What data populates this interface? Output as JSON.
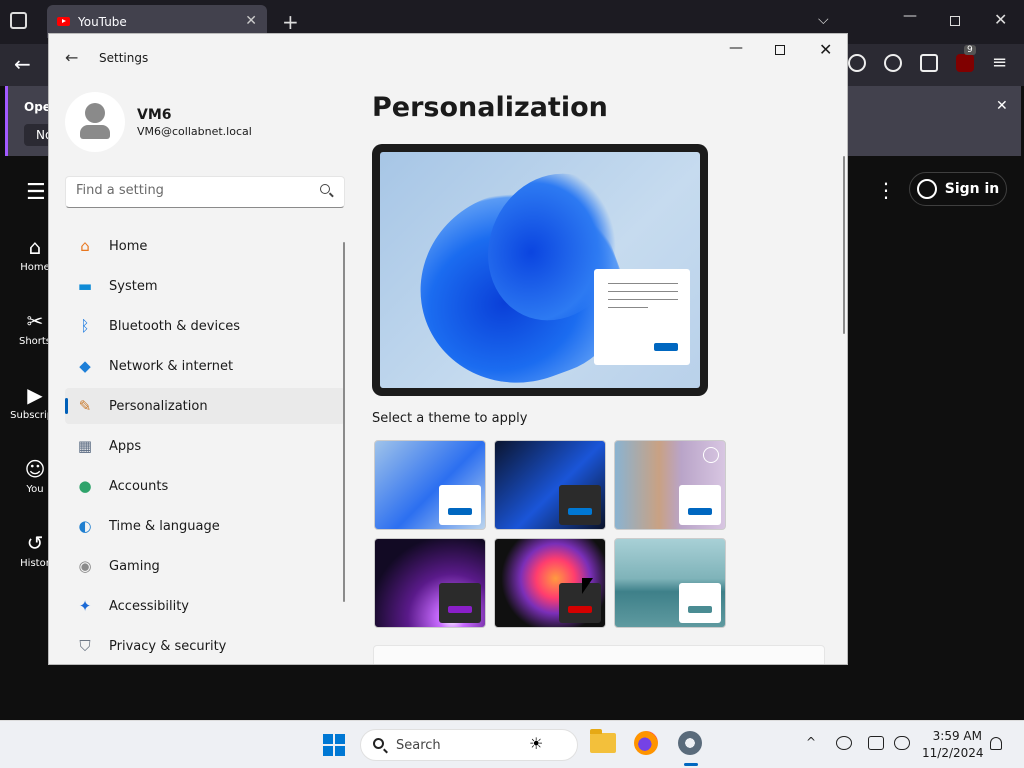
{
  "browser": {
    "tab_title": "YouTube",
    "notification": {
      "text": "Oper",
      "button": "No"
    },
    "extension_badge": "9"
  },
  "youtube": {
    "sidebar": [
      {
        "label": "Home",
        "icon": "home-icon",
        "glyph": "⌂"
      },
      {
        "label": "Shorts",
        "icon": "shorts-icon",
        "glyph": "✂"
      },
      {
        "label": "Subscripti",
        "icon": "subscriptions-icon",
        "glyph": "▶"
      },
      {
        "label": "You",
        "icon": "you-icon",
        "glyph": "☺"
      },
      {
        "label": "Histor",
        "icon": "history-icon",
        "glyph": "↺"
      }
    ],
    "sign_in": "Sign in"
  },
  "settings": {
    "window_title": "Settings",
    "user": {
      "name": "VM6",
      "email": "VM6@collabnet.local"
    },
    "search": {
      "placeholder": "Find a setting"
    },
    "nav": [
      {
        "label": "Home",
        "icon": "home-icon",
        "glyph": "⌂",
        "color": "#e8761e",
        "active": false
      },
      {
        "label": "System",
        "icon": "system-icon",
        "glyph": "▬",
        "color": "#0f8bd6",
        "active": false
      },
      {
        "label": "Bluetooth & devices",
        "icon": "bluetooth-icon",
        "glyph": "ᛒ",
        "color": "#1c7ae0",
        "active": false
      },
      {
        "label": "Network & internet",
        "icon": "wifi-icon",
        "glyph": "◆",
        "color": "#1d7fd8",
        "active": false
      },
      {
        "label": "Personalization",
        "icon": "brush-icon",
        "glyph": "✎",
        "color": "#c97a2c",
        "active": true
      },
      {
        "label": "Apps",
        "icon": "apps-icon",
        "glyph": "▦",
        "color": "#5b6b82",
        "active": false
      },
      {
        "label": "Accounts",
        "icon": "accounts-icon",
        "glyph": "●",
        "color": "#2fa36b",
        "active": false
      },
      {
        "label": "Time & language",
        "icon": "globe-icon",
        "glyph": "◐",
        "color": "#1f7fd0",
        "active": false
      },
      {
        "label": "Gaming",
        "icon": "gamepad-icon",
        "glyph": "◉",
        "color": "#8a8a8a",
        "active": false
      },
      {
        "label": "Accessibility",
        "icon": "accessibility-icon",
        "glyph": "✦",
        "color": "#1c6ad6",
        "active": false
      },
      {
        "label": "Privacy & security",
        "icon": "shield-icon",
        "glyph": "⛉",
        "color": "#6d7785",
        "active": false
      }
    ],
    "page_title": "Personalization",
    "theme_section_label": "Select a theme to apply",
    "themes": [
      {
        "name": "windows-light",
        "bg": "linear-gradient(135deg,#9fc3ea,#2c6ff0 55%,#bcd5ee)",
        "card": "#ffffff",
        "button": "#0067c0"
      },
      {
        "name": "windows-dark",
        "bg": "linear-gradient(135deg,#0b1530,#1a55d8 55%,#0a1228)",
        "card": "#2b2b2b",
        "button": "#0078d4"
      },
      {
        "name": "glow-spotlight",
        "bg": "linear-gradient(90deg,#8ab3d1,#c9a183 40%,#b9a4c8 60%,#d8c6e2)",
        "card": "#ffffff",
        "button": "#0067c0"
      },
      {
        "name": "glow",
        "bg": "radial-gradient(circle at 70% 90%,#ffffff 0,#c86bff 12%,#5a1a8a 40%,#120a24 75%)",
        "card": "#2b2b2b",
        "button": "#8a1fc9"
      },
      {
        "name": "captured-motion",
        "bg": "radial-gradient(circle at 55% 45%,#ff9b3f 0,#ff3d6e 25%,#7a2fb8 45%,#101010 70%)",
        "card": "#2b2b2b",
        "button": "#d40000"
      },
      {
        "name": "flow",
        "bg": "linear-gradient(180deg,#a8d0d6,#7fb3b9 45%,#3e8089 60%,#5f9aa0)",
        "card": "#ffffff",
        "button": "#4a8c93"
      }
    ]
  },
  "taskbar": {
    "search_text": "Search",
    "time": "3:59 AM",
    "date": "11/2/2024"
  }
}
